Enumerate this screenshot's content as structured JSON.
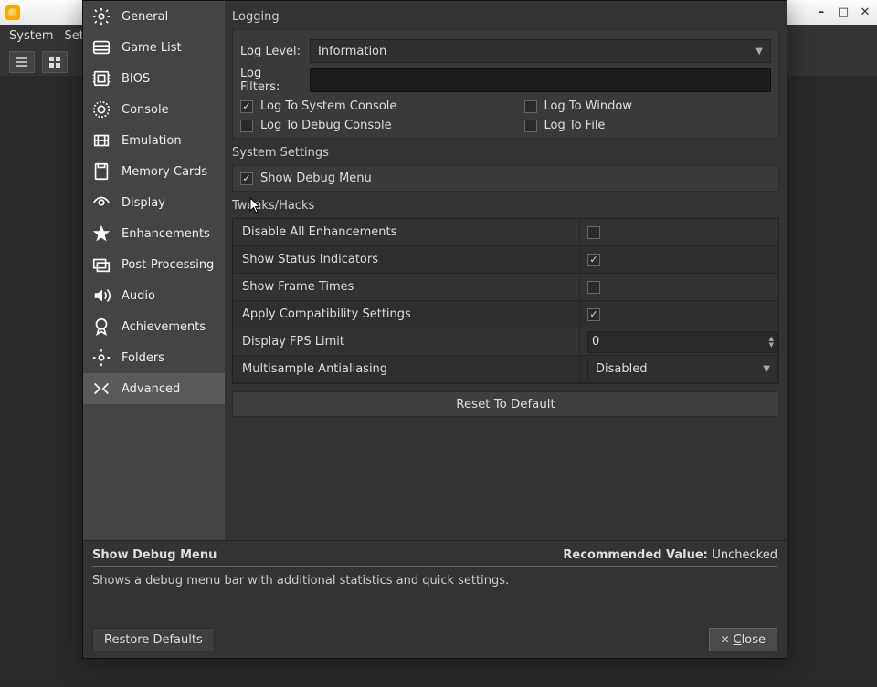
{
  "mainWindow": {
    "menubar": [
      "System",
      "Settings"
    ],
    "windowButtons": {
      "min": "–",
      "max": "□",
      "close": "✕"
    }
  },
  "sidebar": {
    "items": [
      {
        "id": "general",
        "label": "General"
      },
      {
        "id": "gamelist",
        "label": "Game List"
      },
      {
        "id": "bios",
        "label": "BIOS"
      },
      {
        "id": "console",
        "label": "Console"
      },
      {
        "id": "emulation",
        "label": "Emulation"
      },
      {
        "id": "memorycards",
        "label": "Memory Cards"
      },
      {
        "id": "display",
        "label": "Display"
      },
      {
        "id": "enhancements",
        "label": "Enhancements"
      },
      {
        "id": "postprocessing",
        "label": "Post-Processing"
      },
      {
        "id": "audio",
        "label": "Audio"
      },
      {
        "id": "achievements",
        "label": "Achievements"
      },
      {
        "id": "folders",
        "label": "Folders"
      },
      {
        "id": "advanced",
        "label": "Advanced"
      }
    ],
    "selected": "advanced"
  },
  "logging": {
    "group_title": "Logging",
    "log_level_label": "Log Level:",
    "log_level_value": "Information",
    "log_filters_label": "Log Filters:",
    "log_filters_value": "",
    "checks": {
      "system_console": {
        "label": "Log To System Console",
        "checked": true
      },
      "window": {
        "label": "Log To Window",
        "checked": false
      },
      "debug_console": {
        "label": "Log To Debug Console",
        "checked": false
      },
      "file": {
        "label": "Log To File",
        "checked": false
      }
    }
  },
  "system_settings": {
    "group_title": "System Settings",
    "show_debug_menu": {
      "label": "Show Debug Menu",
      "checked": true
    }
  },
  "tweaks": {
    "group_title": "Tweaks/Hacks",
    "rows": [
      {
        "label": "Disable All Enhancements",
        "type": "check",
        "checked": false
      },
      {
        "label": "Show Status Indicators",
        "type": "check",
        "checked": true
      },
      {
        "label": "Show Frame Times",
        "type": "check",
        "checked": false
      },
      {
        "label": "Apply Compatibility Settings",
        "type": "check",
        "checked": true
      },
      {
        "label": "Display FPS Limit",
        "type": "spin",
        "value": "0"
      },
      {
        "label": "Multisample Antialiasing",
        "type": "select",
        "value": "Disabled"
      }
    ],
    "reset_label": "Reset To Default"
  },
  "tooltip": {
    "title": "Show Debug Menu",
    "recommended_label": "Recommended Value:",
    "recommended_value": "Unchecked",
    "body": "Shows a debug menu bar with additional statistics and quick settings."
  },
  "footer": {
    "restore": "Restore Defaults",
    "close": "Close",
    "close_prefix": "C"
  }
}
